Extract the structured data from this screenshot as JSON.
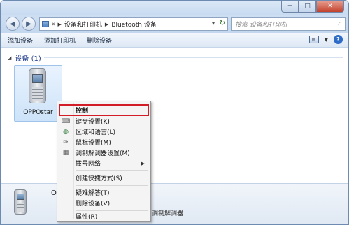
{
  "window": {
    "minimize_glyph": "─",
    "maximize_glyph": "□",
    "close_glyph": "✕"
  },
  "nav": {
    "back_icon": "arrow-left-icon",
    "forward_icon": "arrow-right-icon"
  },
  "address": {
    "prefix": "«",
    "crumb1": "设备和打印机",
    "sep": "▶",
    "crumb2": "Bluetooth 设备",
    "dropdown": "▾",
    "refresh": "↻"
  },
  "search": {
    "placeholder": "搜索 设备和打印机",
    "icon": "search-icon"
  },
  "toolbar": {
    "add_device": "添加设备",
    "add_printer": "添加打印机",
    "remove_device": "删除设备",
    "help": "?"
  },
  "group": {
    "title": "设备 (1)",
    "toggle": "◢"
  },
  "device": {
    "name": "OPPOstar",
    "icon": "mobile-phone-icon"
  },
  "details": {
    "name": "OI",
    "category": "调制解调器"
  },
  "context_menu": {
    "items": [
      {
        "label": "控制",
        "icon": ""
      },
      {
        "label": "键盘设置(K)",
        "icon": "keyboard-icon"
      },
      {
        "label": "区域和语言(L)",
        "icon": "globe-icon"
      },
      {
        "label": "鼠标设置(M)",
        "icon": "mouse-icon"
      },
      {
        "label": "调制解调器设置(M)",
        "icon": "modem-icon"
      },
      {
        "label": "拨号网络",
        "icon": "",
        "submenu": "▶"
      },
      {
        "label": "创建快捷方式(S)",
        "icon": ""
      },
      {
        "label": "疑难解答(T)",
        "icon": ""
      },
      {
        "label": "删除设备(V)",
        "icon": ""
      },
      {
        "label": "属性(R)",
        "icon": ""
      }
    ]
  },
  "colors": {
    "highlight_border": "#d21c28",
    "window_border": "#6d8bb0",
    "group_title": "#1e3a8a",
    "selection_bg": "#cde3f9"
  }
}
